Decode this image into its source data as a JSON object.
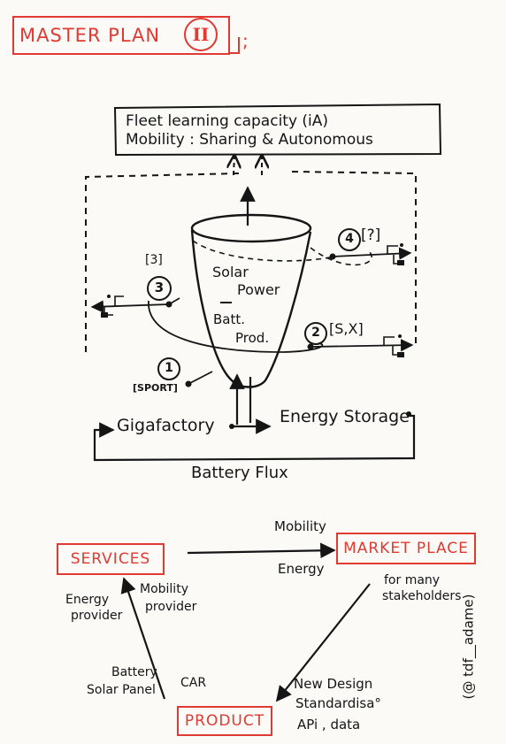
{
  "title": {
    "text": "MASTER PLAN",
    "numeral": "II",
    "suffix": ";"
  },
  "top_box": {
    "line1": "Fleet learning capacity (iA)",
    "line2": "Mobility : Sharing & Autonomous"
  },
  "cup": {
    "solar1": "Solar",
    "solar2": "Power",
    "batt1": "Batt.",
    "batt2": "Prod."
  },
  "steps": [
    {
      "num": "1",
      "tag": "[SPORT]"
    },
    {
      "num": "2",
      "tag": "[S,X]"
    },
    {
      "num": "3",
      "tag": "[3]"
    },
    {
      "num": "4",
      "tag": "[?]"
    }
  ],
  "flow": {
    "gigafactory": "Gigafactory",
    "energy_storage": "Energy Storage",
    "battery_flux": "Battery Flux"
  },
  "bottom": {
    "services": "SERVICES",
    "market_place": "MARKET PLACE",
    "product": "PRODUCT",
    "mobility": "Mobility",
    "energy": "Energy",
    "for_many1": "for many",
    "for_many2": "stakeholders",
    "energy_provider1": "Energy",
    "energy_provider2": "provider",
    "mobility_provider1": "Mobility",
    "mobility_provider2": "provider",
    "battery": "Battery",
    "solar_panel": "Solar Panel",
    "car": "CAR",
    "new_design": "New Design",
    "standardisa": "Standardisa°",
    "api": "APi , data"
  },
  "signature": "(@ tdf__adame)",
  "colors": {
    "accent_red": "#e03a32",
    "ink": "#151515",
    "paper": "#fbfaf7"
  }
}
